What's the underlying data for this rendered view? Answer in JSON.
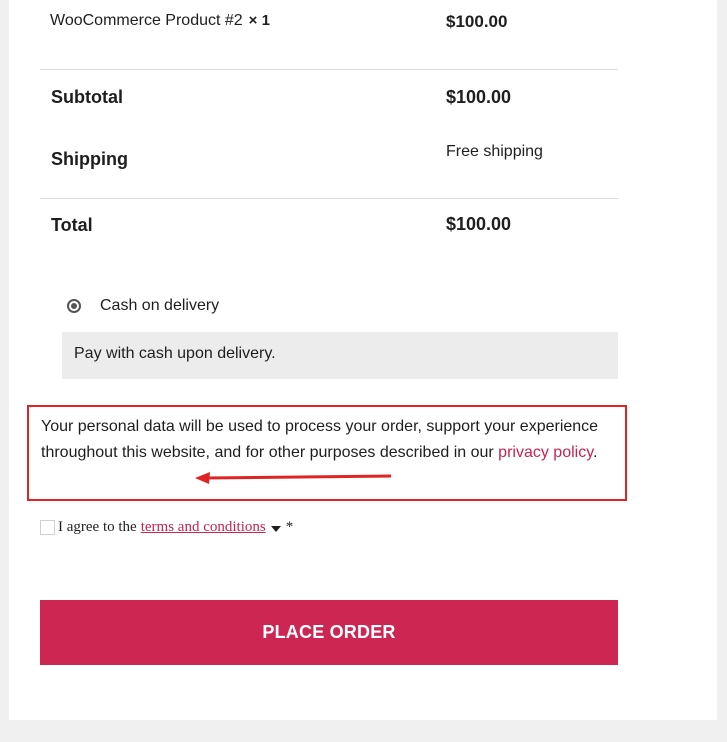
{
  "order_review": {
    "product": {
      "name": "WooCommerce Product #2",
      "quantity": "× 1",
      "price": "$100.00"
    },
    "subtotal": {
      "label": "Subtotal",
      "value": "$100.00"
    },
    "shipping": {
      "label": "Shipping",
      "value": "Free shipping"
    },
    "total": {
      "label": "Total",
      "value": "$100.00"
    }
  },
  "payment": {
    "method_label": "Cash on delivery",
    "description": "Pay with cash upon delivery."
  },
  "privacy": {
    "text_before": "Your personal data will be used to process your order, support your experience throughout this website, and for other purposes described in our ",
    "link_text": "privacy policy",
    "text_after": "."
  },
  "terms": {
    "prefix": "I agree to the",
    "link_text": "terms and conditions",
    "required_mark": "*"
  },
  "place_order": {
    "label": "PLACE ORDER"
  },
  "colors": {
    "accent": "#cd2653",
    "highlight_border": "#e02424",
    "link": "#c9234f"
  }
}
